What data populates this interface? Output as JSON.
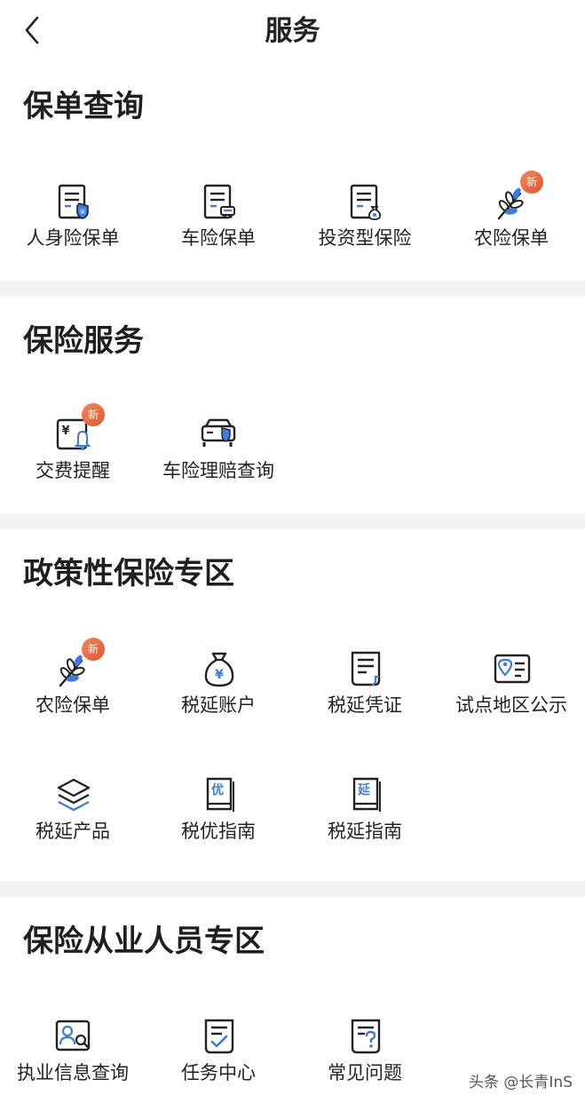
{
  "header": {
    "title": "服务"
  },
  "sections": [
    {
      "title": "保单查询",
      "items": [
        {
          "label": "人身险保单"
        },
        {
          "label": "车险保单"
        },
        {
          "label": "投资型保险"
        },
        {
          "label": "农险保单",
          "badge": "新"
        }
      ]
    },
    {
      "title": "保险服务",
      "items": [
        {
          "label": "交费提醒",
          "badge": "新"
        },
        {
          "label": "车险理赔查询"
        }
      ]
    },
    {
      "title": "政策性保险专区",
      "items": [
        {
          "label": "农险保单",
          "badge": "新"
        },
        {
          "label": "税延账户"
        },
        {
          "label": "税延凭证"
        },
        {
          "label": "试点地区公示"
        },
        {
          "label": "税延产品"
        },
        {
          "label": "税优指南",
          "glyph": "优"
        },
        {
          "label": "税延指南",
          "glyph": "延"
        }
      ]
    },
    {
      "title": "保险从业人员专区",
      "items": [
        {
          "label": "执业信息查询"
        },
        {
          "label": "任务中心"
        },
        {
          "label": "常见问题"
        }
      ]
    }
  ],
  "icon_glyphs": {
    "yen": "¥"
  },
  "watermark": "头条 @长青InS",
  "colors": {
    "accent": "#3d7be0",
    "badge": "#e9643a",
    "divider": "#f2f2f2",
    "icon_stroke": "#222222"
  }
}
